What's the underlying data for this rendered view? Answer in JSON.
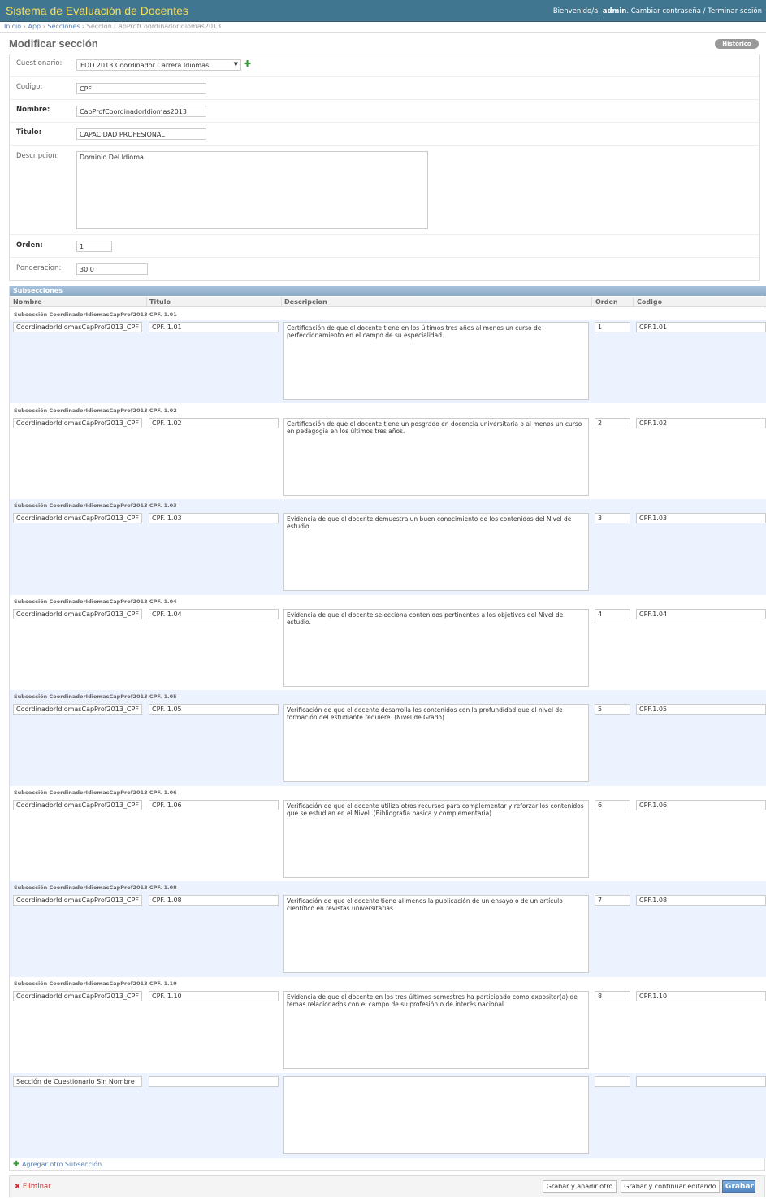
{
  "header": {
    "title": "Sistema de Evaluación de Docentes",
    "welcome": "Bienvenido/a,",
    "user": "admin",
    "change_password": "Cambiar contraseña",
    "separator": "/",
    "logout": "Terminar sesión"
  },
  "breadcrumb": {
    "home": "Inicio",
    "app": "App",
    "sections": "Secciones",
    "current": "Sección CapProfCoordinadorIdiomas2013",
    "sep": "›"
  },
  "page": {
    "title": "Modificar sección",
    "history": "Histórico"
  },
  "form": {
    "cuestionario_label": "Cuestionario:",
    "cuestionario_value": "EDD 2013 Coordinador Carrera Idiomas",
    "codigo_label": "Codigo:",
    "codigo_value": "CPF",
    "nombre_label": "Nombre:",
    "nombre_value": "CapProfCoordinadorIdiomas2013",
    "titulo_label": "Titulo:",
    "titulo_value": "CAPACIDAD PROFESIONAL",
    "descripcion_label": "Descripcion:",
    "descripcion_value": "Dominio Del Idioma",
    "orden_label": "Orden:",
    "orden_value": "1",
    "ponderacion_label": "Ponderacion:",
    "ponderacion_value": "30.0"
  },
  "inline": {
    "title": "Subsecciones",
    "columns": {
      "nombre": "Nombre",
      "titulo": "Titulo",
      "descripcion": "Descripcion",
      "orden": "Orden",
      "codigo": "Codigo"
    },
    "rows": [
      {
        "label": "Subsección CoordinadorIdiomasCapProf2013  CPF. 1.01",
        "nombre": "CoordinadorIdiomasCapProf2013_CPF",
        "titulo": "CPF. 1.01",
        "descripcion": "Certificación de que el docente tiene en los últimos tres años al menos un curso de perfeccionamiento en el campo de su especialidad.",
        "orden": "1",
        "codigo": "CPF.1.01"
      },
      {
        "label": "Subsección CoordinadorIdiomasCapProf2013  CPF. 1.02",
        "nombre": "CoordinadorIdiomasCapProf2013_CPF",
        "titulo": "CPF. 1.02",
        "descripcion": "Certificación de que el docente tiene un posgrado en docencia universitaria o al menos un curso en pedagogía en los últimos tres años.",
        "orden": "2",
        "codigo": "CPF.1.02"
      },
      {
        "label": "Subsección CoordinadorIdiomasCapProf2013  CPF. 1.03",
        "nombre": "CoordinadorIdiomasCapProf2013_CPF",
        "titulo": "CPF. 1.03",
        "descripcion": "Evidencia de que el docente demuestra un buen conocimiento de los contenidos del Nivel de estudio.",
        "orden": "3",
        "codigo": "CPF.1.03"
      },
      {
        "label": "Subsección CoordinadorIdiomasCapProf2013  CPF. 1.04",
        "nombre": "CoordinadorIdiomasCapProf2013_CPF",
        "titulo": "CPF. 1.04",
        "descripcion": "Evidencia de que el docente selecciona contenidos pertinentes a los objetivos del Nivel de estudio.",
        "orden": "4",
        "codigo": "CPF.1.04"
      },
      {
        "label": "Subsección CoordinadorIdiomasCapProf2013  CPF. 1.05",
        "nombre": "CoordinadorIdiomasCapProf2013_CPF",
        "titulo": "CPF. 1.05",
        "descripcion": "Verificación de que el docente desarrolla los contenidos con la profundidad que el nivel de formación del estudiante requiere. (Nivel de Grado)",
        "orden": "5",
        "codigo": "CPF.1.05"
      },
      {
        "label": "Subsección CoordinadorIdiomasCapProf2013  CPF. 1.06",
        "nombre": "CoordinadorIdiomasCapProf2013_CPF",
        "titulo": "CPF. 1.06",
        "descripcion": "Verificación de que el docente utiliza otros recursos para complementar y reforzar los contenidos que se estudian en el Nivel. (Bibliografía básica y complementaria)",
        "orden": "6",
        "codigo": "CPF.1.06"
      },
      {
        "label": "Subsección CoordinadorIdiomasCapProf2013  CPF. 1.08",
        "nombre": "CoordinadorIdiomasCapProf2013_CPF",
        "titulo": "CPF. 1.08",
        "descripcion": "Verificación de que el docente tiene al menos la publicación de un ensayo o de un artículo científico en revistas universitarias.",
        "orden": "7",
        "codigo": "CPF.1.08"
      },
      {
        "label": "Subsección CoordinadorIdiomasCapProf2013  CPF. 1.10",
        "nombre": "CoordinadorIdiomasCapProf2013_CPF",
        "titulo": "CPF. 1.10",
        "descripcion": "Evidencia de que el docente en los tres últimos semestres ha participado como expositor(a) de temas relacionados con el campo de su profesión o de interés nacional.",
        "orden": "8",
        "codigo": "CPF.1.10"
      }
    ],
    "empty_row": {
      "nombre": "Sección de Cuestionario Sin Nombre",
      "titulo": "",
      "descripcion": "",
      "orden": "",
      "codigo": ""
    },
    "add_another": "Agregar otro Subsección."
  },
  "submit": {
    "delete": "Eliminar",
    "save_add": "Grabar y añadir otro",
    "save_continue": "Grabar y continuar editando",
    "save": "Grabar"
  }
}
